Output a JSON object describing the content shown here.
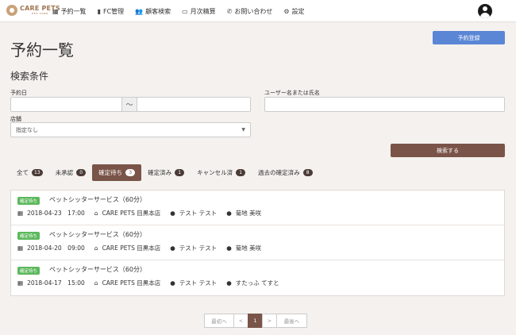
{
  "brand": {
    "name": "CARE PETS",
    "sub": "PET CARE"
  },
  "nav": [
    {
      "icon": "calendar-icon",
      "glyph": "▦",
      "label": "予約一覧"
    },
    {
      "icon": "building-icon",
      "glyph": "▮",
      "label": "FC管理"
    },
    {
      "icon": "users-icon",
      "glyph": "👥",
      "label": "顧客検索"
    },
    {
      "icon": "money-icon",
      "glyph": "▭",
      "label": "月次精算"
    },
    {
      "icon": "phone-icon",
      "glyph": "✆",
      "label": "お問い合わせ"
    },
    {
      "icon": "gear-icon",
      "glyph": "⚙",
      "label": "設定"
    }
  ],
  "page": {
    "title": "予約一覧",
    "register_label": "予約登録"
  },
  "search": {
    "title": "検索条件",
    "date_label": "予約日",
    "date_from": "",
    "date_to": "",
    "tilde": "〜",
    "user_label": "ユーザー名または氏名",
    "user_value": "",
    "store_label": "店舗",
    "store_selected": "指定なし",
    "submit_label": "検索する"
  },
  "tabs": [
    {
      "label": "全て",
      "count": "13",
      "active": false
    },
    {
      "label": "未承認",
      "count": "0",
      "active": false
    },
    {
      "label": "確定待ち",
      "count": "3",
      "active": true
    },
    {
      "label": "確定済み",
      "count": "1",
      "active": false
    },
    {
      "label": "キャンセル済",
      "count": "1",
      "active": false
    },
    {
      "label": "過去の確定済み",
      "count": "8",
      "active": false
    }
  ],
  "reservations": [
    {
      "status": "確定待ち",
      "service": "ペットシッターサービス（60分）",
      "datetime": "2018-04-23　17:00",
      "store": "CARE PETS 目黒本店",
      "customer": "テスト テスト",
      "staff": "菊地 美咲"
    },
    {
      "status": "確定待ち",
      "service": "ペットシッターサービス（60分）",
      "datetime": "2018-04-20　09:00",
      "store": "CARE PETS 目黒本店",
      "customer": "テスト テスト",
      "staff": "菊地 美咲"
    },
    {
      "status": "確定待ち",
      "service": "ペットシッターサービス（60分）",
      "datetime": "2018-04-17　15:00",
      "store": "CARE PETS 目黒本店",
      "customer": "テスト テスト",
      "staff": "すたっふ てすと"
    }
  ],
  "pagination": {
    "first": "最初へ",
    "prev": "<",
    "current": "1",
    "next": ">",
    "last": "最後へ"
  },
  "colors": {
    "accent": "#7a5448",
    "primary": "#5b86d5",
    "status_green": "#5cb85c",
    "background": "#f4f1ee"
  }
}
